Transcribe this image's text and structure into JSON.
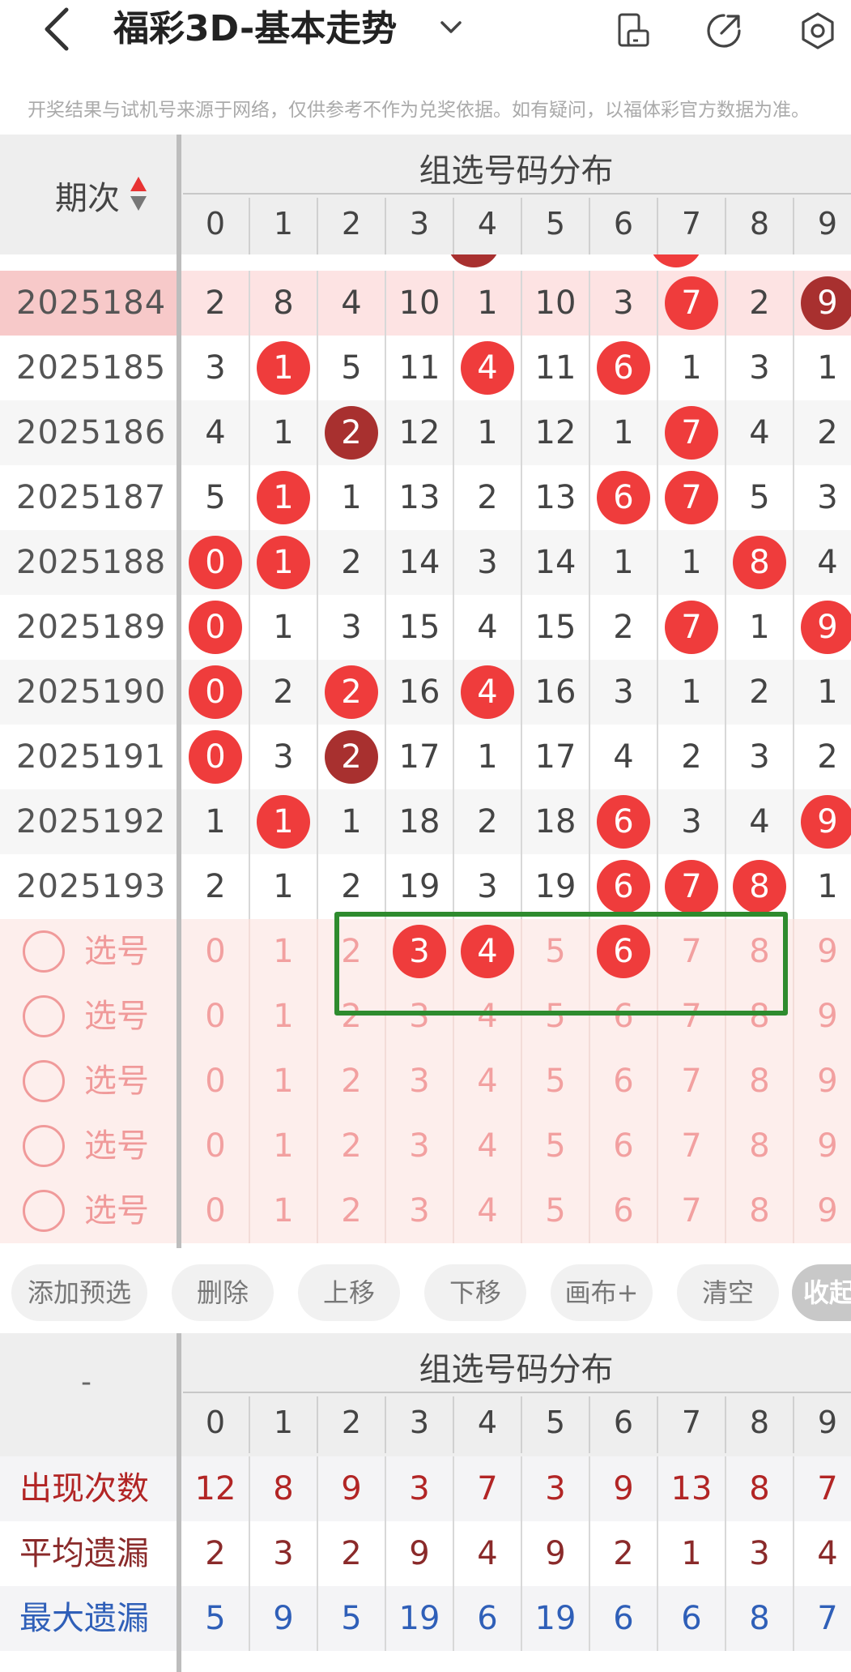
{
  "header": {
    "title": "福彩3D-基本走势",
    "back_icon": "chevron-left-icon",
    "dropdown_icon": "chevron-down-icon",
    "icons": [
      "phone-orientation-icon",
      "share-icon",
      "settings-icon"
    ]
  },
  "disclaimer": "开奖结果与试机号来源于网络，仅供参考不作为兑奖依据。如有疑问，以福体彩官方数据为准。",
  "table": {
    "period_header": "期次",
    "dist_title": "组选号码分布",
    "columns": [
      "0",
      "1",
      "2",
      "3",
      "4",
      "5",
      "6",
      "7",
      "8",
      "9"
    ],
    "rows": [
      {
        "period": "2025184",
        "cells": [
          "2",
          "8",
          "4",
          "10",
          "1",
          "10",
          "3",
          "7",
          "2",
          "9"
        ],
        "balls": {
          "7": "red",
          "9": "dark"
        },
        "highlight": true
      },
      {
        "period": "2025185",
        "cells": [
          "3",
          "1",
          "5",
          "11",
          "4",
          "11",
          "6",
          "1",
          "3",
          "1"
        ],
        "balls": {
          "1": "red",
          "4": "red",
          "6": "red"
        }
      },
      {
        "period": "2025186",
        "cells": [
          "4",
          "1",
          "2",
          "12",
          "1",
          "12",
          "1",
          "7",
          "4",
          "2"
        ],
        "balls": {
          "2": "dark",
          "7": "red"
        }
      },
      {
        "period": "2025187",
        "cells": [
          "5",
          "1",
          "1",
          "13",
          "2",
          "13",
          "6",
          "7",
          "5",
          "3"
        ],
        "balls": {
          "1": "red",
          "6": "red",
          "7": "red"
        }
      },
      {
        "period": "2025188",
        "cells": [
          "0",
          "1",
          "2",
          "14",
          "3",
          "14",
          "1",
          "1",
          "8",
          "4"
        ],
        "balls": {
          "0": "red",
          "1": "red",
          "8": "red"
        }
      },
      {
        "period": "2025189",
        "cells": [
          "0",
          "1",
          "3",
          "15",
          "4",
          "15",
          "2",
          "7",
          "1",
          "9"
        ],
        "balls": {
          "0": "red",
          "7": "red",
          "9": "red"
        }
      },
      {
        "period": "2025190",
        "cells": [
          "0",
          "2",
          "2",
          "16",
          "4",
          "16",
          "3",
          "1",
          "2",
          "1"
        ],
        "balls": {
          "0": "red",
          "2": "red",
          "4": "red"
        }
      },
      {
        "period": "2025191",
        "cells": [
          "0",
          "3",
          "2",
          "17",
          "1",
          "17",
          "4",
          "2",
          "3",
          "2"
        ],
        "balls": {
          "0": "red",
          "2": "dark"
        }
      },
      {
        "period": "2025192",
        "cells": [
          "1",
          "1",
          "1",
          "18",
          "2",
          "18",
          "6",
          "3",
          "4",
          "9"
        ],
        "balls": {
          "1": "red",
          "6": "red",
          "9": "red"
        }
      },
      {
        "period": "2025193",
        "cells": [
          "2",
          "1",
          "2",
          "19",
          "3",
          "19",
          "6",
          "7",
          "8",
          "1"
        ],
        "balls": {
          "6": "red",
          "7": "red",
          "8": "red"
        }
      }
    ],
    "select_rows": [
      {
        "label": "选号",
        "selected": [
          "3",
          "4",
          "6"
        ]
      },
      {
        "label": "选号",
        "selected": []
      },
      {
        "label": "选号",
        "selected": []
      },
      {
        "label": "选号",
        "selected": []
      },
      {
        "label": "选号",
        "selected": []
      }
    ]
  },
  "actions": [
    "添加预选",
    "删除",
    "上移",
    "下移",
    "画布+",
    "清空",
    "收起"
  ],
  "stats": {
    "left_header": "-",
    "dist_title": "组选号码分布",
    "columns": [
      "0",
      "1",
      "2",
      "3",
      "4",
      "5",
      "6",
      "7",
      "8",
      "9"
    ],
    "rows": [
      {
        "label": "出现次数",
        "color": "#b22525",
        "values": [
          "12",
          "8",
          "9",
          "3",
          "7",
          "3",
          "9",
          "13",
          "8",
          "7"
        ]
      },
      {
        "label": "平均遗漏",
        "color": "#8a2a2a",
        "values": [
          "2",
          "3",
          "2",
          "9",
          "4",
          "9",
          "2",
          "1",
          "3",
          "4"
        ]
      },
      {
        "label": "最大遗漏",
        "color": "#2f5fb8",
        "values": [
          "5",
          "9",
          "5",
          "19",
          "6",
          "19",
          "6",
          "6",
          "8",
          "7"
        ]
      }
    ]
  },
  "colors": {
    "ball_red": "#ef3c3c",
    "ball_dark": "#a8302f",
    "highlight_row": "#fde3e3",
    "select_bg": "#fdeeec",
    "box_green": "#2e8b2e"
  }
}
